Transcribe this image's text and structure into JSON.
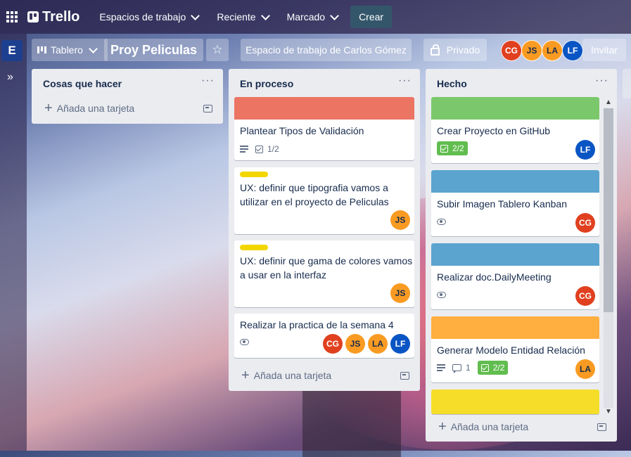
{
  "topbar": {
    "logo": "Trello",
    "nav": [
      {
        "label": "Espacios de trabajo"
      },
      {
        "label": "Reciente"
      },
      {
        "label": "Marcado"
      }
    ],
    "create_label": "Crear"
  },
  "board": {
    "workspace_badge": "E",
    "view_label": "Tablero",
    "title": "Proy Peliculas",
    "workspace_name": "Espacio de trabajo de Carlos Gómez",
    "visibility": "Privado",
    "invite_label": "Invitar",
    "members": [
      "CG",
      "JS",
      "LA",
      "LF"
    ]
  },
  "lists": [
    {
      "title": "Cosas que hacer",
      "menu": "···",
      "add_card": "Añada una tarjeta"
    },
    {
      "title": "En proceso",
      "menu": "···",
      "add_card": "Añada una tarjeta",
      "cards": [
        {
          "cover_color": "#eb7463",
          "title": "Plantear Tipos de Validación",
          "checklist": "1/2"
        },
        {
          "label_color": "#f2d600",
          "title_lines": [
            "UX: definir que tipografia vamos a",
            "utilizar en el proyecto de Peliculas"
          ],
          "members": [
            "JS"
          ]
        },
        {
          "label_color": "#f2d600",
          "title_lines": [
            "UX: definir que gama de colores vamos",
            "a usar en la interfaz"
          ],
          "members": [
            "JS"
          ]
        },
        {
          "title": "Realizar la practica de la semana 4",
          "members": [
            "CG",
            "JS",
            "LA",
            "LF"
          ]
        }
      ]
    },
    {
      "title": "Hecho",
      "menu": "···",
      "add_card": "Añada una tarjeta",
      "cards": [
        {
          "cover_color": "#7bc86c",
          "title": "Crear Proyecto en GitHub",
          "checklist": "2/2",
          "members": [
            "LF"
          ]
        },
        {
          "cover_color": "#5ba4cf",
          "title": "Subir Imagen Tablero Kanban",
          "members": [
            "CG"
          ]
        },
        {
          "cover_color": "#5ba4cf",
          "title": "Realizar doc.DailyMeeting",
          "members": [
            "CG"
          ]
        },
        {
          "cover_color": "#ffaf3f",
          "title": "Generar Modelo Entidad Relación",
          "comments": "1",
          "checklist": "2/2",
          "members": [
            "LA"
          ]
        },
        {
          "cover_color": "#f5dd29"
        }
      ]
    }
  ],
  "icons": {
    "apps": "apps-grid-icon",
    "star": "☆",
    "expand": "»",
    "scroll_up": "▲",
    "scroll_down": "▼"
  }
}
